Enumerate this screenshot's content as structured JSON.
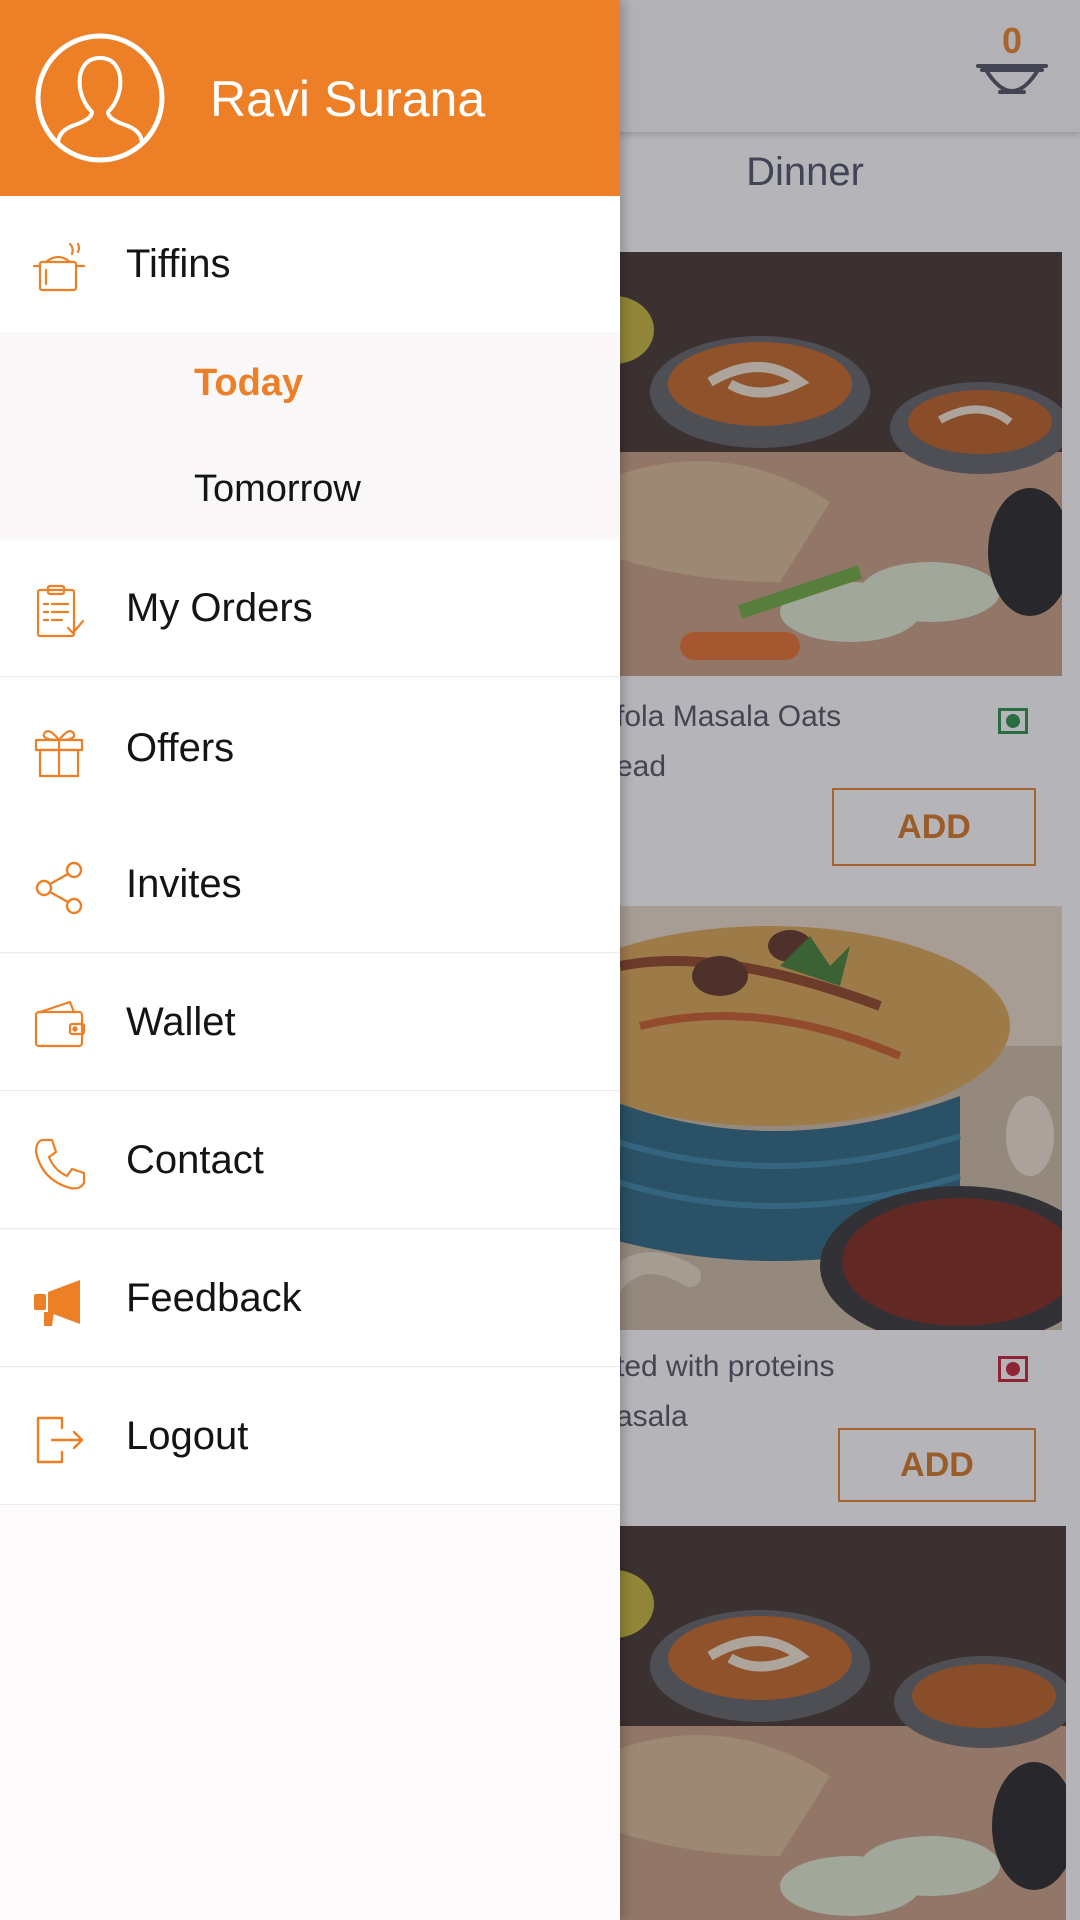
{
  "app": {
    "cart_count": "0",
    "meal_tab": "Dinner",
    "cards": [
      {
        "title_line1": "fola Masala Oats",
        "title_line2": "ead",
        "diet": "veg",
        "add_label": "ADD"
      },
      {
        "title_line1": "ted with proteins",
        "title_line2": "asala",
        "diet": "non-veg",
        "add_label": "ADD"
      }
    ]
  },
  "drawer": {
    "user_name": "Ravi Surana",
    "menu": [
      {
        "label": "Tiffins",
        "icon": "cooking-pot-icon"
      },
      {
        "label": "My Orders",
        "icon": "clipboard-checklist-icon"
      },
      {
        "label": "Offers",
        "icon": "gift-icon"
      },
      {
        "label": "Invites",
        "icon": "share-icon"
      },
      {
        "label": "Wallet",
        "icon": "wallet-icon"
      },
      {
        "label": "Contact",
        "icon": "phone-icon"
      },
      {
        "label": "Feedback",
        "icon": "megaphone-icon"
      },
      {
        "label": "Logout",
        "icon": "logout-icon"
      }
    ],
    "submenu": [
      {
        "label": "Today",
        "selected": true
      },
      {
        "label": "Tomorrow",
        "selected": false
      }
    ]
  },
  "colors": {
    "accent": "#ed7f26",
    "veg": "#1e8b3c",
    "non_veg": "#c0152b"
  }
}
